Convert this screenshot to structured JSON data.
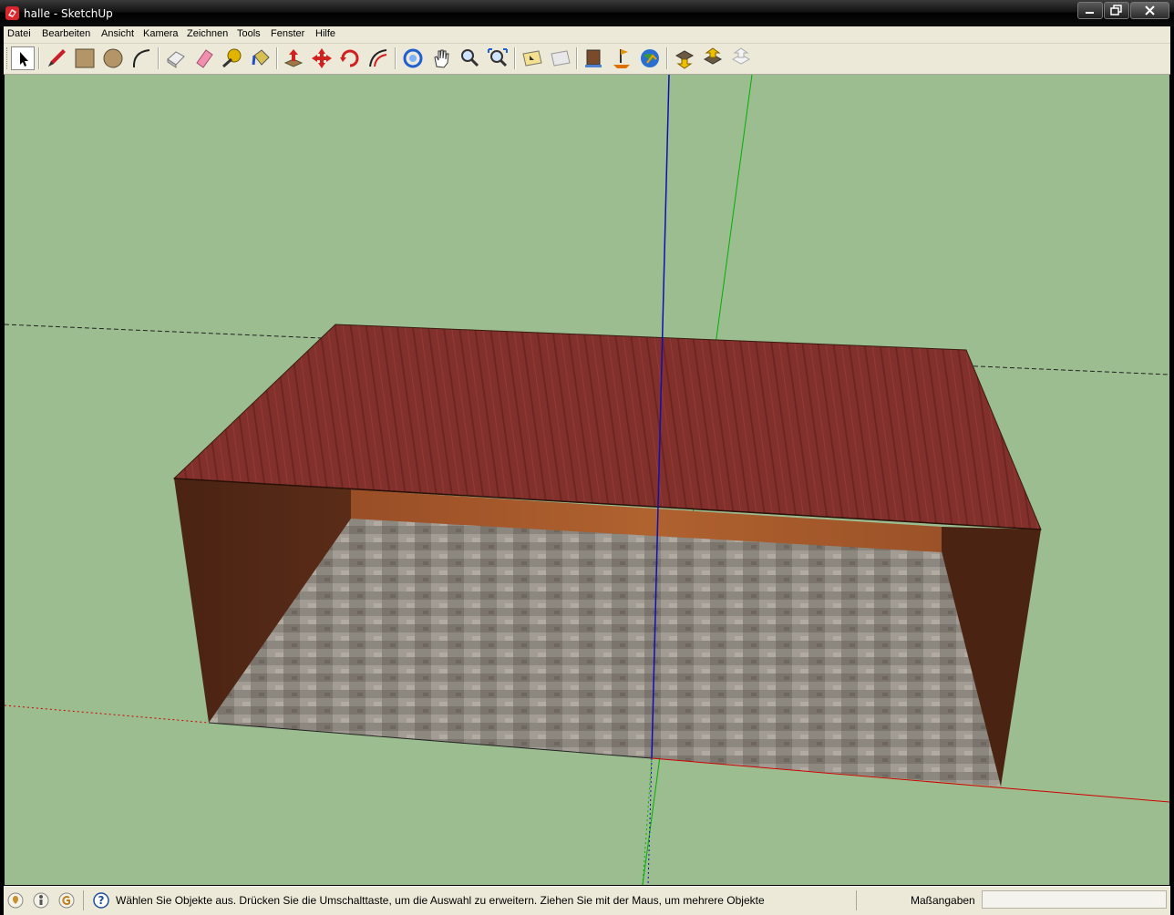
{
  "window": {
    "title": "halle - SketchUp",
    "buttons": [
      "minimize",
      "maximize",
      "close"
    ]
  },
  "menubar": {
    "items": [
      "Datei",
      "Bearbeiten",
      "Ansicht",
      "Kamera",
      "Zeichnen",
      "Tools",
      "Fenster",
      "Hilfe"
    ]
  },
  "toolbar": {
    "tools": [
      {
        "name": "select-icon",
        "active": true
      },
      {
        "name": "pencil-icon"
      },
      {
        "name": "rectangle-icon"
      },
      {
        "name": "circle-icon"
      },
      {
        "name": "arc-icon"
      },
      {
        "name": "make-component-icon"
      },
      {
        "name": "eraser-icon"
      },
      {
        "name": "tape-measure-icon"
      },
      {
        "name": "paint-bucket-icon"
      },
      {
        "name": "push-pull-icon"
      },
      {
        "name": "move-icon"
      },
      {
        "name": "rotate-icon"
      },
      {
        "name": "offset-icon"
      },
      {
        "name": "orbit-icon"
      },
      {
        "name": "pan-icon"
      },
      {
        "name": "zoom-icon"
      },
      {
        "name": "zoom-extents-icon"
      },
      {
        "name": "previous-view-icon"
      },
      {
        "name": "next-view-icon"
      },
      {
        "name": "get-models-icon"
      },
      {
        "name": "add-location-icon"
      },
      {
        "name": "google-earth-icon"
      },
      {
        "name": "get-models-warehouse-icon"
      },
      {
        "name": "share-model-icon"
      },
      {
        "name": "share-component-icon"
      }
    ]
  },
  "viewport": {
    "background": "#9bbd90",
    "roof_color": "#82302c",
    "wall_color": "#4e2615",
    "back_wall_color": "#a7582c",
    "floor_color": "#8f8a83",
    "axis_red": "#d00000",
    "axis_green": "#00b000",
    "axis_blue": "#1010b0"
  },
  "statusbar": {
    "icons": [
      "geo-location-icon",
      "credits-icon",
      "user-icon"
    ],
    "help_icon": "help-icon",
    "message": "Wählen Sie Objekte aus. Drücken Sie die Umschalttaste, um die Auswahl zu erweitern. Ziehen Sie mit der Maus, um mehrere Objekte",
    "measurements_label": "Maßangaben",
    "measurements_value": ""
  }
}
